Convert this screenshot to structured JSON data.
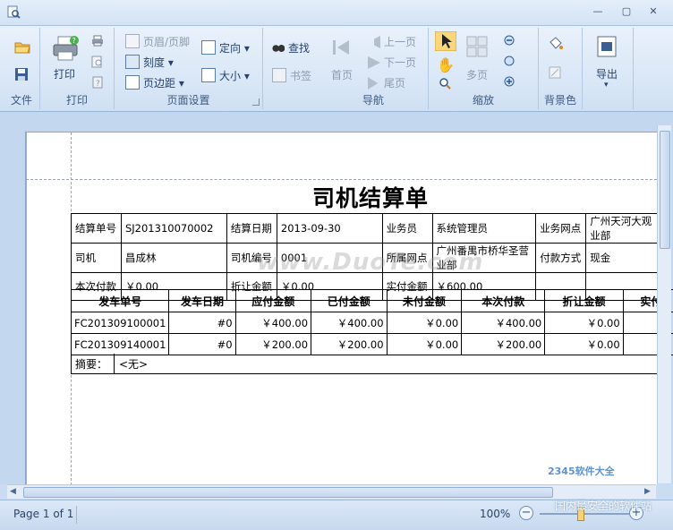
{
  "window": {
    "minimize": "—",
    "restore": "▢",
    "close": "✕"
  },
  "ribbon": {
    "file_group": {
      "label": "文件"
    },
    "print_group": {
      "label": "打印",
      "print": "打印"
    },
    "page_setup": {
      "label": "页面设置",
      "header_footer": "页眉/页脚",
      "scale": "刻度",
      "margins": "页边距",
      "orientation": "定向",
      "size": "大小"
    },
    "find": {
      "find": "查找",
      "bookmark": "书签"
    },
    "navigation": {
      "label": "导航",
      "first": "首页",
      "prev": "上一页",
      "next": "下一页",
      "last": "尾页"
    },
    "zoom": {
      "label": "缩放",
      "multipage": "多页"
    },
    "background": {
      "label": "背景色"
    },
    "export": {
      "label": "导出"
    }
  },
  "report": {
    "title": "司机结算单",
    "info_rows": [
      [
        {
          "k": "结算单号",
          "v": "SJ201310070002"
        },
        {
          "k": "结算日期",
          "v": "2013-09-30"
        },
        {
          "k": "业务员",
          "v": "系统管理员"
        },
        {
          "k": "业务网点",
          "v": "广州天河大观业部"
        }
      ],
      [
        {
          "k": "司机",
          "v": "昌成林"
        },
        {
          "k": "司机编号",
          "v": "0001"
        },
        {
          "k": "所属网点",
          "v": "广州番禺市桥华圣营业部"
        },
        {
          "k": "付款方式",
          "v": "现金"
        }
      ],
      [
        {
          "k": "本次付款",
          "v": "￥0.00"
        },
        {
          "k": "折让金额",
          "v": "￥0.00"
        },
        {
          "k": "实付金额",
          "v": "￥600.00"
        },
        {
          "k": "",
          "v": ""
        }
      ]
    ],
    "detail_headers": [
      "发车单号",
      "发车日期",
      "应付金额",
      "已付金额",
      "未付金额",
      "本次付款",
      "折让金额",
      "实付"
    ],
    "detail_rows": [
      [
        "FC201309100001",
        "#0",
        "￥400.00",
        "￥400.00",
        "￥0.00",
        "￥400.00",
        "￥0.00",
        ""
      ],
      [
        "FC201309140001",
        "#0",
        "￥200.00",
        "￥200.00",
        "￥0.00",
        "￥200.00",
        "￥0.00",
        ""
      ]
    ],
    "summary_label": "摘要：",
    "summary_value": "<无>"
  },
  "watermark": "www.DuoTe.com",
  "status": {
    "page": "Page 1 of 1",
    "zoom": "100%",
    "minus": "−",
    "plus": "+"
  },
  "branding": {
    "line1": "2345软件大全",
    "line2": "国内最安全的软件站"
  }
}
